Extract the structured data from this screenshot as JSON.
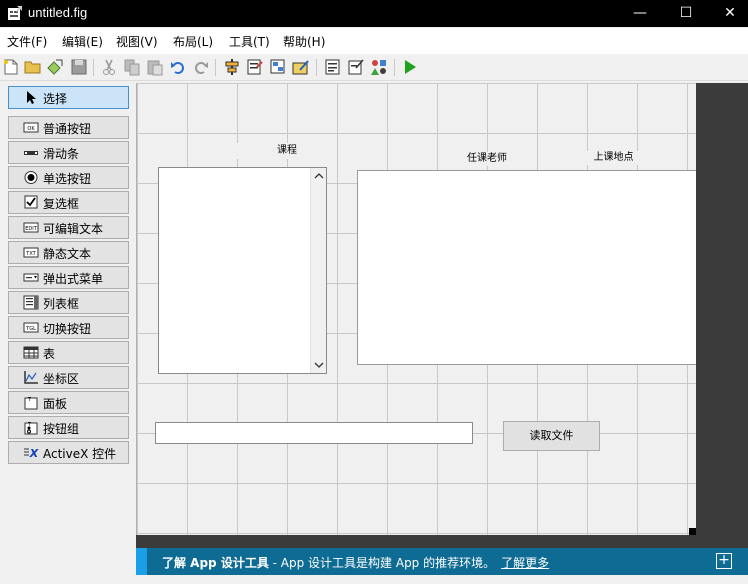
{
  "window": {
    "title": "untitled.fig",
    "minimize": "—",
    "maximize": "☐",
    "close": "✕"
  },
  "menubar": {
    "items": [
      "文件(F)",
      "编辑(E)",
      "视图(V)",
      "布局(L)",
      "工具(T)",
      "帮助(H)"
    ]
  },
  "palette": {
    "items": [
      {
        "label": "选择",
        "icon": "cursor-icon",
        "selected": true
      },
      {
        "label": "普通按钮",
        "icon": "pushbutton-icon"
      },
      {
        "label": "滑动条",
        "icon": "slider-icon"
      },
      {
        "label": "单选按钮",
        "icon": "radio-icon"
      },
      {
        "label": "复选框",
        "icon": "checkbox-icon"
      },
      {
        "label": "可编辑文本",
        "icon": "edit-text-icon"
      },
      {
        "label": "静态文本",
        "icon": "static-text-icon"
      },
      {
        "label": "弹出式菜单",
        "icon": "popup-menu-icon"
      },
      {
        "label": "列表框",
        "icon": "listbox-icon"
      },
      {
        "label": "切换按钮",
        "icon": "toggle-icon"
      },
      {
        "label": "表",
        "icon": "table-icon"
      },
      {
        "label": "坐标区",
        "icon": "axes-icon"
      },
      {
        "label": "面板",
        "icon": "panel-icon"
      },
      {
        "label": "按钮组",
        "icon": "button-group-icon"
      },
      {
        "label": "ActiveX 控件",
        "icon": "activex-icon"
      }
    ]
  },
  "canvas": {
    "label_course": "课程",
    "label_teacher": "任课老师",
    "label_location": "上课地点",
    "read_button": "读取文件",
    "edit_value": ""
  },
  "banner": {
    "title": "了解 App 设计工具",
    "text": " - App 设计工具是构建 App 的推荐环境。",
    "link": "了解更多",
    "expand": "+"
  },
  "colors": {
    "titlebar": "#000000",
    "banner": "#0e6b93",
    "banner_accent": "#1a9ee8",
    "palette_selected": "#cce4f7"
  }
}
